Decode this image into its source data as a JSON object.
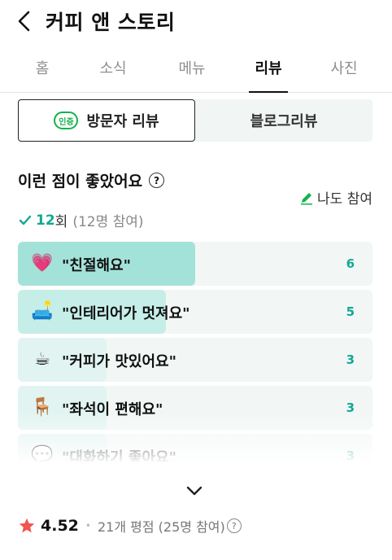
{
  "header": {
    "title": "커피 앤 스토리"
  },
  "tabs": [
    {
      "label": "홈",
      "active": false
    },
    {
      "label": "소식",
      "active": false
    },
    {
      "label": "메뉴",
      "active": false
    },
    {
      "label": "리뷰",
      "active": true
    },
    {
      "label": "사진",
      "active": false
    }
  ],
  "review_type": {
    "cert_badge": "인증",
    "visitor_label": "방문자 리뷰",
    "blog_label": "블로그리뷰"
  },
  "highlights": {
    "title": "이런 점이 좋았어요",
    "help_icon": "?",
    "join_label": "나도 참여",
    "count": "12",
    "count_suffix": "회",
    "participants": "(12명 참여)",
    "accent_color": "#13a891",
    "items": [
      {
        "emoji": "💗",
        "icon": "heart-face-icon",
        "label": "\"친절해요\"",
        "count": "6",
        "fraction": 0.5,
        "fill_color": "#a3e2d9"
      },
      {
        "emoji": "🛋️",
        "icon": "sofa-icon",
        "label": "\"인테리어가 멋져요\"",
        "count": "5",
        "fraction": 0.417,
        "fill_color": "#c6eee8"
      },
      {
        "emoji": "☕",
        "icon": "coffee-icon",
        "label": "\"커피가 맛있어요\"",
        "count": "3",
        "fraction": 0.25,
        "fill_color": "#e2f4f1"
      },
      {
        "emoji": "🪑",
        "icon": "armchair-icon",
        "label": "\"좌석이 편해요\"",
        "count": "3",
        "fraction": 0.25,
        "fill_color": "#e2f4f1"
      },
      {
        "emoji": "💬",
        "icon": "chat-icon",
        "label": "\"대화하기 좋아요\"",
        "count": "3",
        "fraction": 0.25,
        "fill_color": "#e2f4f1"
      }
    ]
  },
  "rating": {
    "value": "4.52",
    "meta": "21개 평점 (25명 참여)",
    "help_icon": "?",
    "star_color": "#f2544f"
  }
}
